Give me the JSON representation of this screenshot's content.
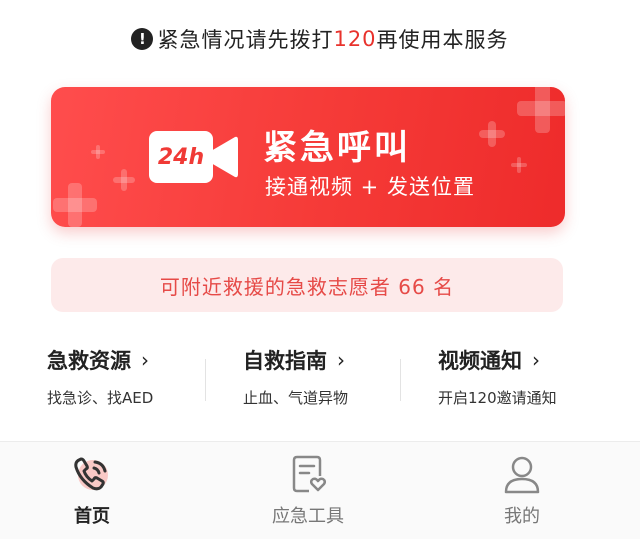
{
  "notice": {
    "icon": "exclamation-icon",
    "prefix": "紧急情况请先拨打",
    "number": "120",
    "suffix": "再使用本服务"
  },
  "emergency_call": {
    "badge": "24h",
    "title": "紧急呼叫",
    "subtitle": "接通视频 + 发送位置",
    "icon": "video-camera-icon",
    "color": "#f03a36"
  },
  "volunteers": {
    "text": "可附近救援的急救志愿者 66 名"
  },
  "quick_links": [
    {
      "title": "急救资源",
      "desc": "找急诊、找AED"
    },
    {
      "title": "自救指南",
      "desc": "止血、气道异物"
    },
    {
      "title": "视频通知",
      "desc": "开启120邀请通知"
    }
  ],
  "tabbar": [
    {
      "label": "首页",
      "icon": "phone-call-icon",
      "active": true
    },
    {
      "label": "应急工具",
      "icon": "document-heart-icon",
      "active": false
    },
    {
      "label": "我的",
      "icon": "user-icon",
      "active": false
    }
  ],
  "colors": {
    "accent": "#f03a36",
    "volunteer_bg": "#fdeaea"
  }
}
